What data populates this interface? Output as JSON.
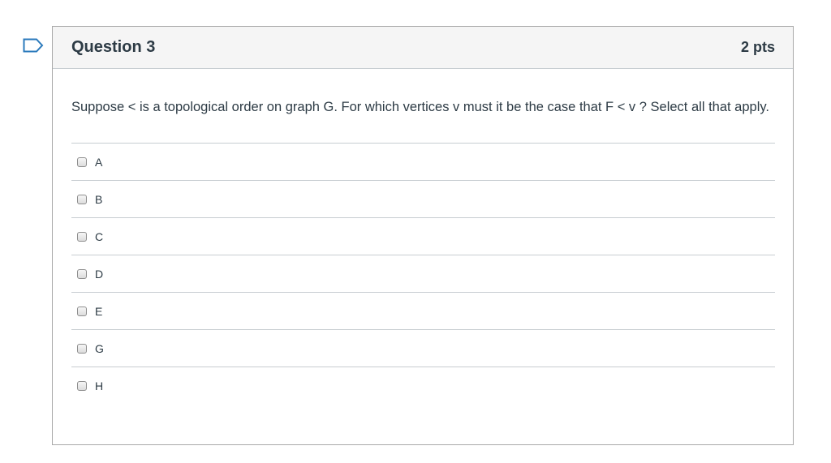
{
  "question": {
    "title": "Question 3",
    "points": "2 pts",
    "text": "Suppose < is a topological order on graph G. For which vertices v must it be the case that F < v ? Select all that apply."
  },
  "answers": [
    {
      "label": "A"
    },
    {
      "label": "B"
    },
    {
      "label": "C"
    },
    {
      "label": "D"
    },
    {
      "label": "E"
    },
    {
      "label": "G"
    },
    {
      "label": "H"
    }
  ],
  "colors": {
    "flag": "#2b7abc",
    "header_bg": "#f5f5f5",
    "border": "#c7cdd1",
    "text": "#2d3b45"
  },
  "icons": {
    "flag": "bookmark-flag-icon"
  }
}
